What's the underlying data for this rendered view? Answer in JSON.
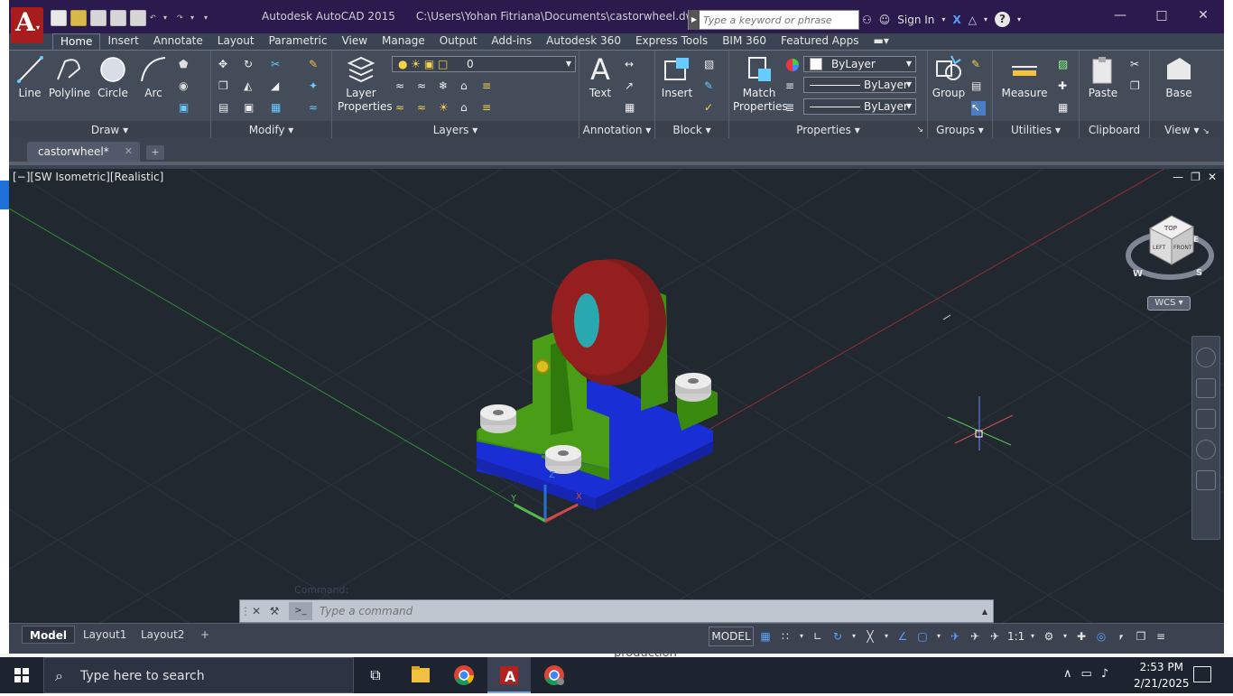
{
  "app": {
    "title": "Autodesk AutoCAD 2015",
    "file_path": "C:\\Users\\Yohan Fitriana\\Documents\\castorwheel.dwg",
    "search_placeholder": "Type a keyword or phrase",
    "sign_in": "Sign In"
  },
  "ribbon_tabs": [
    "Home",
    "Insert",
    "Annotate",
    "Layout",
    "Parametric",
    "View",
    "Manage",
    "Output",
    "Add-ins",
    "Autodesk 360",
    "Express Tools",
    "BIM 360",
    "Featured Apps"
  ],
  "panels": {
    "draw": {
      "title": "Draw",
      "line": "Line",
      "polyline": "Polyline",
      "circle": "Circle",
      "arc": "Arc"
    },
    "modify": {
      "title": "Modify"
    },
    "layers": {
      "title": "Layers",
      "layer_properties": "Layer\nProperties",
      "current_layer": "0"
    },
    "annotation": {
      "title": "Annotation",
      "text": "Text"
    },
    "block": {
      "title": "Block",
      "insert": "Insert"
    },
    "properties": {
      "title": "Properties",
      "match_properties": "Match\nProperties",
      "color": "ByLayer",
      "linetype": "ByLayer",
      "lineweight": "ByLayer"
    },
    "groups": {
      "title": "Groups",
      "group": "Group"
    },
    "utilities": {
      "title": "Utilities",
      "measure": "Measure"
    },
    "clipboard": {
      "title": "Clipboard",
      "paste": "Paste"
    },
    "view": {
      "title": "View",
      "base": "Base"
    }
  },
  "document": {
    "tab": "castorwheel*",
    "viewport_label": "[−][SW Isometric][Realistic]"
  },
  "viewcube": {
    "top": "TOP",
    "left": "LEFT",
    "front": "FRONT",
    "compass_w": "W",
    "compass_s": "S",
    "compass_e": "E",
    "wcs": "WCS"
  },
  "command": {
    "placeholder": "Type a command",
    "ghost": "Command:"
  },
  "layouts": [
    "Model",
    "Layout1",
    "Layout2"
  ],
  "status": {
    "model": "MODEL",
    "scale": "1:1"
  },
  "taskbar": {
    "search": "Type here to search",
    "time": "2:53 PM",
    "date": "2/21/2025"
  },
  "behind_window_text": "production",
  "colors": {
    "title_bg": "#2a1a4e",
    "ribbon_bg": "#444b59",
    "viewport_bg": "#212830",
    "wheel": "#7d1c1c",
    "base": "#1a2ed6",
    "bracket": "#3b8a10"
  }
}
